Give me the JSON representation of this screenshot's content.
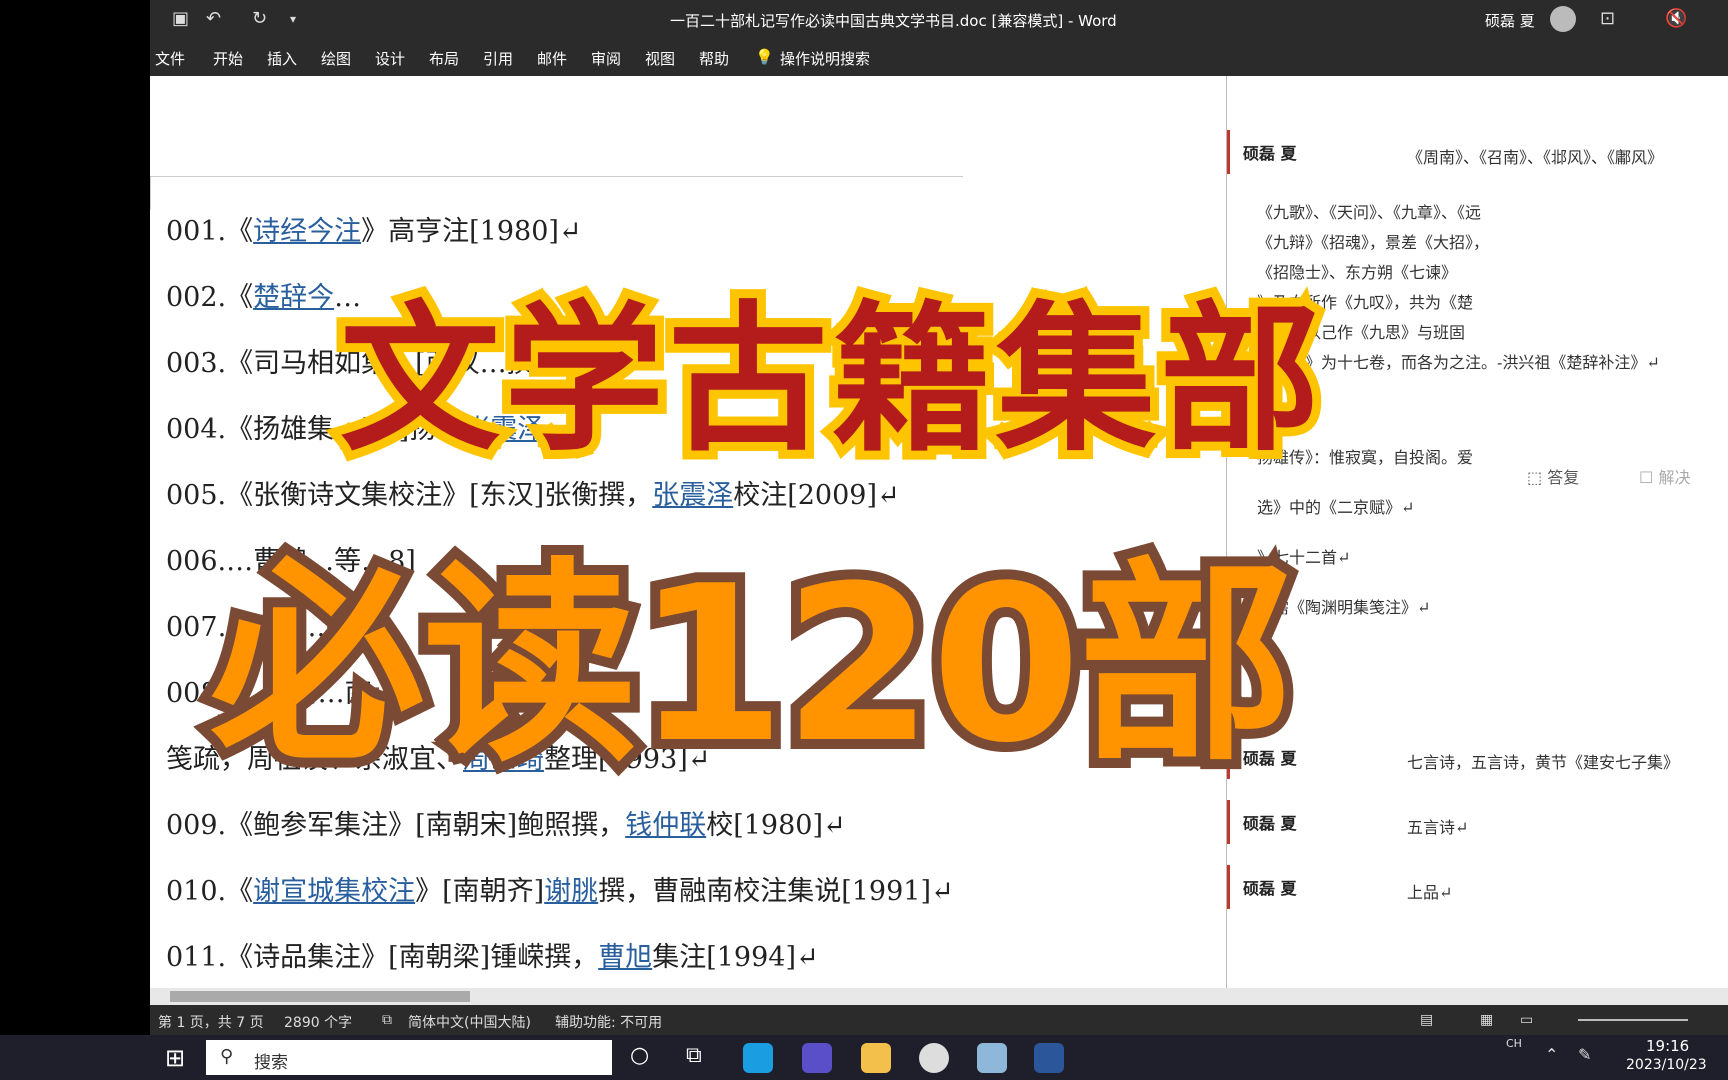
{
  "titlebar": {
    "title": "一百二十部札记写作必读中国古典文学书目.doc [兼容模式]  -  Word",
    "user": "硕磊 夏"
  },
  "ribbon": {
    "menus": [
      "文件",
      "开始",
      "插入",
      "绘图",
      "设计",
      "布局",
      "引用",
      "邮件",
      "审阅",
      "视图",
      "帮助"
    ],
    "search": "操作说明搜索"
  },
  "document": {
    "lines": [
      {
        "num": "001.",
        "parts": [
          {
            "t": "《"
          },
          {
            "t": "诗经今注",
            "link": true
          },
          {
            "t": "》"
          },
          {
            "t": "高亨注[1980]↵"
          }
        ]
      },
      {
        "num": "002.",
        "parts": [
          {
            "t": "《"
          },
          {
            "t": "楚辞今",
            "link": true
          },
          {
            "t": "…"
          }
        ]
      },
      {
        "num": "003.",
        "parts": [
          {
            "t": "《司马相如集"
          },
          {
            "t": "…[西汉…撰…"
          }
        ]
      },
      {
        "num": "004.",
        "parts": [
          {
            "t": "《"
          },
          {
            "t": "扬雄"
          },
          {
            "t": "集…[…]扬…"
          },
          {
            "t": "张震泽",
            "link": true
          }
        ]
      },
      {
        "num": "005.",
        "parts": [
          {
            "t": "《"
          },
          {
            "t": "张衡"
          },
          {
            "t": "诗文集校注》[东汉]张衡撰，"
          },
          {
            "t": "张震泽",
            "link": true
          },
          {
            "t": "校注[2009]↵"
          }
        ]
      },
      {
        "num": "006.",
        "parts": [
          {
            "t": "…曹魏…等…8]"
          }
        ]
      },
      {
        "num": "007",
        "parts": [
          {
            "t": "…斌校…6]↵"
          }
        ]
      },
      {
        "num": "008.",
        "parts": [
          {
            "t": "《…[南…南…林"
          }
        ]
      },
      {
        "num": "",
        "parts": [
          {
            "t": "笺疏，周祖谟、余淑宜、"
          },
          {
            "t": "周士琦",
            "link": true
          },
          {
            "t": "整理[1993]↵"
          }
        ]
      },
      {
        "num": "009.",
        "parts": [
          {
            "t": "《鲍参军集注》"
          },
          {
            "t": "[南朝宋]鲍照撰，"
          },
          {
            "t": "钱仲联",
            "link": true
          },
          {
            "t": "校[1980]↵"
          }
        ]
      },
      {
        "num": "010.",
        "parts": [
          {
            "t": "《"
          },
          {
            "t": "谢宣城集校注",
            "link": true
          },
          {
            "t": "》[南朝齐]"
          },
          {
            "t": "谢朓",
            "link": true
          },
          {
            "t": "撰，曹融南校注集说[1991]↵"
          }
        ]
      },
      {
        "num": "011.",
        "parts": [
          {
            "t": "《诗品集注》"
          },
          {
            "t": "[南朝梁]锺嵘撰，"
          },
          {
            "t": "曹旭",
            "link": true
          },
          {
            "t": "集注[1994]↵"
          }
        ]
      }
    ]
  },
  "comments": [
    {
      "author": "硕磊 夏",
      "text": "《周南》、《召南》、《邶风》、《鄘风》"
    },
    {
      "author": "",
      "text": "《九歌》、《天问》、《九章》、《远"
    },
    {
      "author": "",
      "text": "《九辩》《招魂》，景差《大招》，"
    },
    {
      "author": "",
      "text": "《招隐士》、东方朔《七谏》"
    },
    {
      "author": "",
      "text": "》及向所作《九叹》，共为《楚"
    },
    {
      "author": "",
      "text": "逸又益以己作《九思》与班固"
    },
    {
      "author": "",
      "text": "二《叙》为十七卷，而各为之注。-洪兴祖《楚辞补注》↵"
    },
    {
      "author": "",
      "text": "扬雄传》：惟寂寞，自投阁。爱"
    },
    {
      "author": "",
      "text": "选》中的《二京赋》↵"
    },
    {
      "author": "",
      "text": "》七十二首↵"
    },
    {
      "author": "",
      "text": "行需《陶渊明集笺注》↵"
    },
    {
      "author": "硕磊 夏",
      "text": "七言诗，五言诗，黄节《建安七子集》"
    },
    {
      "author": "硕磊 夏",
      "text": "五言诗↵"
    },
    {
      "author": "硕磊 夏",
      "text": "上品↵"
    }
  ],
  "comment_actions": {
    "reply": "答复",
    "resolve": "解决"
  },
  "overlay": {
    "line1": "文学古籍集部",
    "line2": "必读120部"
  },
  "statusbar": {
    "page": "第 1 页，共 7 页",
    "words": "2890 个字",
    "lang": "简体中文(中国大陆)",
    "access": "辅助功能: 不可用"
  },
  "taskbar": {
    "search": "搜索",
    "ime": "中",
    "ch": "CH",
    "time": "19:16",
    "date": "2023/10/23"
  },
  "colors": {
    "accent": "#b41c1c",
    "overlay_yellow": "#ffc400",
    "overlay_orange": "#ff9400",
    "link": "#2a5f9e"
  }
}
